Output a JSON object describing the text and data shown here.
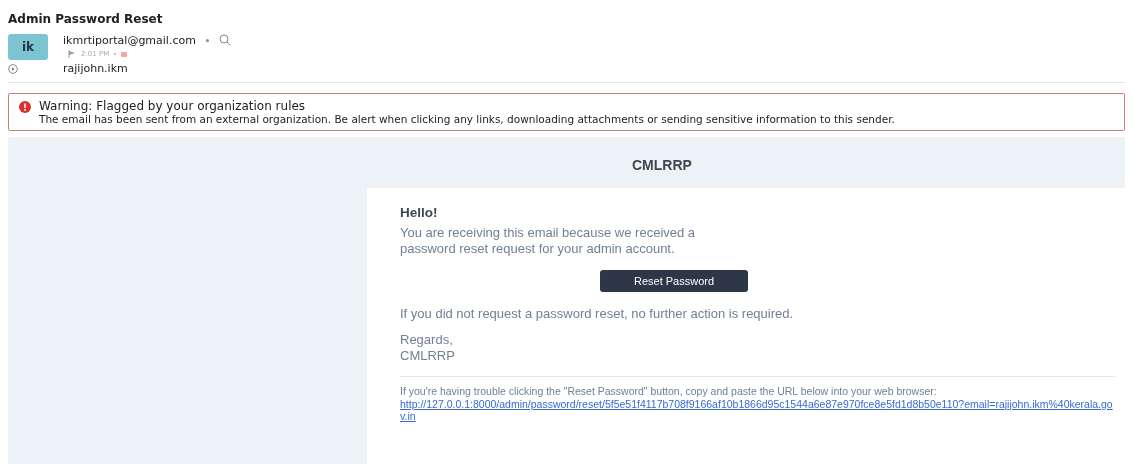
{
  "subject": "Admin Password Reset",
  "sender": {
    "avatar": "ik",
    "email": "ikmrtiportal@gmail.com",
    "flagged": true,
    "time": "2:01 PM",
    "recipient": "rajijohn.ikm"
  },
  "warning": {
    "title": "Warning: Flagged by your organization rules",
    "message": "The email has been sent from an external organization. Be alert when clicking any links, downloading attachments or sending sensitive information to this sender."
  },
  "email": {
    "brand": "CMLRRP",
    "greeting": "Hello!",
    "intro": "You are receiving this email because we received a password reset request for your admin account.",
    "button": "Reset Password",
    "outro": "If you did not request a password reset, no further action is required.",
    "regards": "Regards,",
    "signature": "CMLRRP",
    "trouble": "If you're having trouble clicking the \"Reset Password\" button, copy and paste the URL below into your web browser:",
    "url": "http://127.0.0.1:8000/admin/password/reset/5f5e51f4117b708f9166af10b1866d95c1544a6e87e970fce8e5fd1d8b50e110?email=rajijohn.ikm%40kerala.gov.in"
  }
}
